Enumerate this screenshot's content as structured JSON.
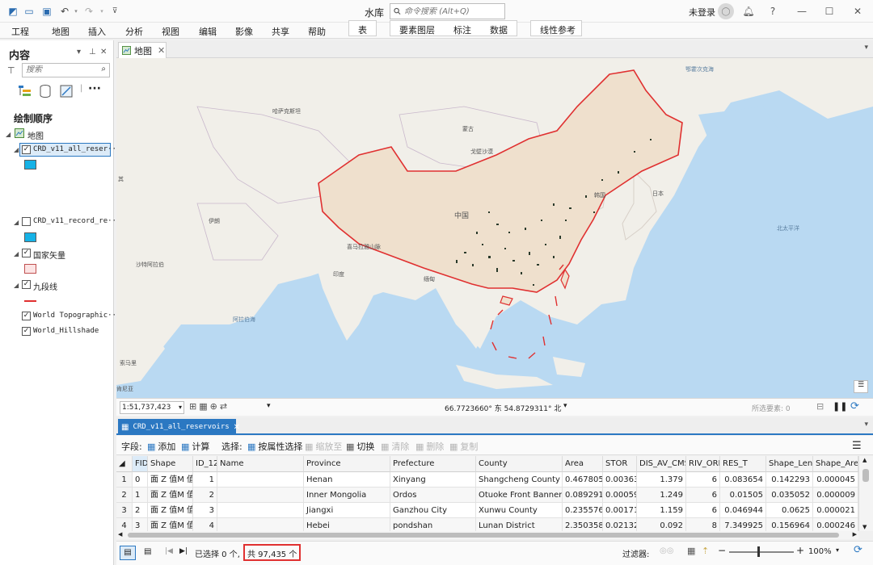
{
  "app": {
    "title": "水库",
    "command_search_placeholder": "命令搜索 (Alt+Q)",
    "login_text": "未登录"
  },
  "ribbon": {
    "tabs": [
      "工程",
      "地图",
      "插入",
      "分析",
      "视图",
      "编辑",
      "影像",
      "共享",
      "帮助",
      "表",
      "要素图层",
      "标注",
      "数据",
      "线性参考"
    ]
  },
  "contents": {
    "title": "内容",
    "search_placeholder": "搜索",
    "section": "绘制顺序",
    "map_node": "地图",
    "layers": [
      {
        "name": "CRD_v11_all_reser···",
        "checked": true,
        "swatch": "#16b2e6"
      },
      {
        "name": "CRD_v11_record_re···",
        "checked": false,
        "swatch": "#16b2e6"
      },
      {
        "name": "国家矢量",
        "checked": true,
        "swatch": "#fce4e4"
      },
      {
        "name": "九段线",
        "checked": true,
        "swatch": "#e03030"
      },
      {
        "name": "World Topographic···",
        "checked": true
      },
      {
        "name": "World_Hillshade",
        "checked": true
      }
    ]
  },
  "map_tab": {
    "label": "地图"
  },
  "map_labels": {
    "china": "中国",
    "mongolia": "蒙古",
    "gobi": "戈壁沙漠",
    "kazakhstan": "哈萨克斯坦",
    "himalaya": "喜马拉雅山脉",
    "india": "印度",
    "iran": "伊朗",
    "saudi": "沙特阿拉伯",
    "arabian_sea": "阿拉伯海",
    "japan": "日本",
    "korea": "韩国",
    "okhotsk": "鄂霍次克海",
    "north_pacific": "北太平洋",
    "myanmar": "缅甸",
    "somalia": "索马里",
    "kenya": "肯尼亚",
    "west_edge": "其"
  },
  "map_status": {
    "scale": "1:51,737,423",
    "coords": "66.7723660° 东 54.8729311° 北",
    "selected_features": "所选要素: 0"
  },
  "attribute_table": {
    "tab_label": "CRD_v11_all_reservoirs",
    "toolbar": {
      "fields_label": "字段:",
      "add": "添加",
      "calculate": "计算",
      "selection_label": "选择:",
      "select_by_attr": "按属性选择",
      "zoom_to": "缩放至",
      "switch": "切换",
      "clear": "清除",
      "delete": "删除",
      "copy": "复制"
    },
    "columns": [
      "FID",
      "Shape",
      "ID_12",
      "Name",
      "Province",
      "Prefecture",
      "County",
      "Area",
      "STOR",
      "DIS_AV_CMS",
      "RIV_ORD",
      "RES_T",
      "Shape_Leng",
      "Shape_Area"
    ],
    "rows": [
      [
        "1",
        "0",
        "面 Z 值M 值",
        "1",
        "",
        "Henan",
        "Xinyang",
        "Shangcheng County",
        "0.467805",
        "0.003638",
        "1.379",
        "6",
        "0.083654",
        "0.142293",
        "0.000045"
      ],
      [
        "2",
        "1",
        "面 Z 值M 值",
        "2",
        "",
        "Inner Mongolia",
        "Ordos",
        "Otuoke Front Banner",
        "0.089291",
        "0.000593",
        "1.249",
        "6",
        "0.01505",
        "0.035052",
        "0.000009"
      ],
      [
        "3",
        "2",
        "面 Z 值M 值",
        "3",
        "",
        "Jiangxi",
        "Ganzhou City",
        "Xunwu County",
        "0.235576",
        "0.001716",
        "1.159",
        "6",
        "0.046944",
        "0.0625",
        "0.000021"
      ],
      [
        "4",
        "3",
        "面 Z 值M 值",
        "4",
        "",
        "Hebei",
        "pondshan",
        "Lunan District",
        "2.350358",
        "0.021324",
        "0.092",
        "8",
        "7.349925",
        "0.156964",
        "0.000246"
      ]
    ]
  },
  "status": {
    "selected_text": "已选择 0 个,",
    "total_text": "共 97,435 个",
    "filter_label": "过滤器:",
    "zoom": "100%"
  },
  "colors": {
    "accent": "#2b78c2",
    "china_border": "#e03030",
    "water": "#b9d9f2",
    "land": "#f1efe9",
    "china_fill": "#efe0cd"
  }
}
